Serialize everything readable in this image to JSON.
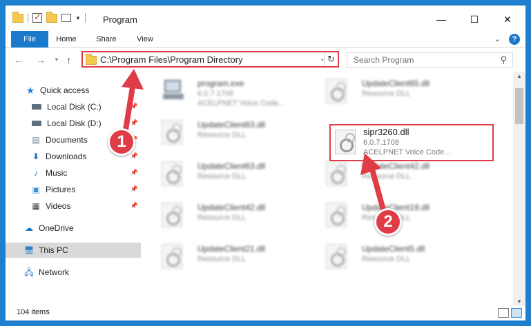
{
  "window": {
    "title": "Program"
  },
  "ribbon": {
    "tabs": [
      {
        "label": "File"
      },
      {
        "label": "Home"
      },
      {
        "label": "Share"
      },
      {
        "label": "View"
      }
    ],
    "help_label": "?"
  },
  "address": {
    "path": "C:\\Program Files\\Program Directory"
  },
  "search": {
    "placeholder": "Search Program"
  },
  "navpane": {
    "items": [
      {
        "label": "Quick access"
      },
      {
        "label": "Local Disk (C:)"
      },
      {
        "label": "Local Disk (D:)"
      },
      {
        "label": "Documents"
      },
      {
        "label": "Downloads"
      },
      {
        "label": "Music"
      },
      {
        "label": "Pictures"
      },
      {
        "label": "Videos"
      },
      {
        "label": "OneDrive"
      },
      {
        "label": "This PC"
      },
      {
        "label": "Network"
      }
    ]
  },
  "files": [
    {
      "name": "program.exe",
      "version": "6.0.7.1708",
      "desc": "ACELPNET Voice Code..."
    },
    {
      "name": "UpdateClient65.dll",
      "version": "Resource DLL"
    },
    {
      "name": "UpdateClient63.dll",
      "version": "Resource DLL"
    },
    {
      "name": "sipr3260.dll",
      "version": "6.0.7.1708",
      "desc": "ACELPNET Voice Code..."
    },
    {
      "name": "UpdateClient63.dll",
      "version": "Resource DLL"
    },
    {
      "name": "UpdateClient42.dll",
      "version": "Resource DLL"
    },
    {
      "name": "UpdateClient42.dll",
      "version": "Resource DLL"
    },
    {
      "name": "UpdateClient19.dll",
      "version": "Resource DLL"
    },
    {
      "name": "UpdateClient21.dll",
      "version": "Resource DLL"
    },
    {
      "name": "UpdateClient5.dll",
      "version": "Resource DLL"
    }
  ],
  "status": {
    "items_count": "104 items"
  },
  "callouts": [
    {
      "label": "1"
    },
    {
      "label": "2"
    }
  ],
  "colors": {
    "accent": "#1979ca",
    "highlight": "#e03c47",
    "selected": "#d9d9d9"
  },
  "icons": [
    "folder-icon",
    "properties-icon",
    "back-arrow-icon",
    "forward-arrow-icon",
    "up-arrow-icon",
    "refresh-icon",
    "search-icon",
    "star-icon",
    "drive-icon",
    "cloud-icon",
    "computer-icon",
    "network-icon",
    "pin-icon"
  ]
}
